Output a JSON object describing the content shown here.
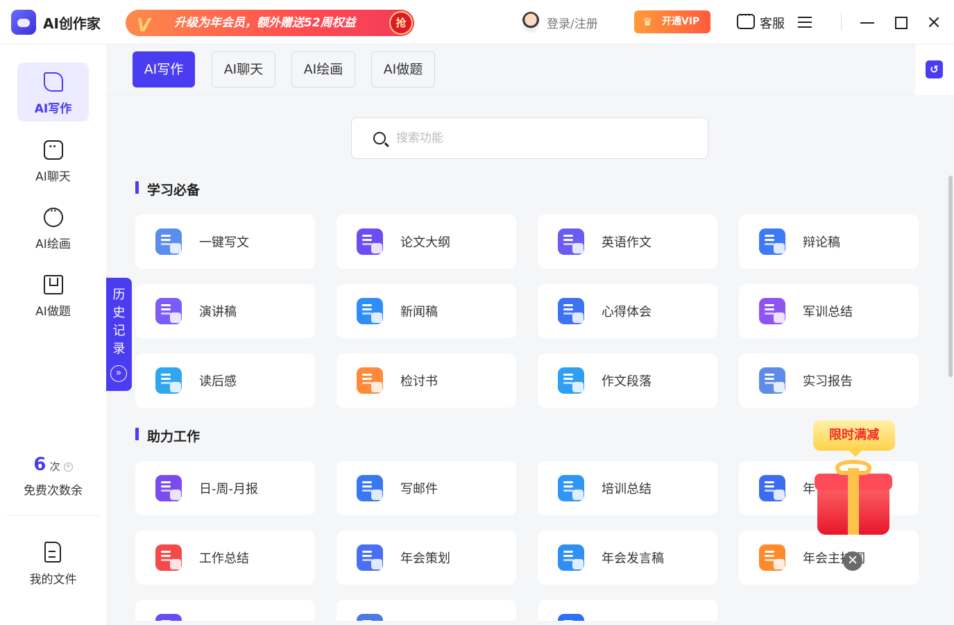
{
  "app": {
    "title": "AI创作家"
  },
  "titlebar": {
    "banner_text": "升级为年会员，额外赠送52周权益",
    "banner_grab": "抢",
    "login": "登录/注册",
    "vip": "开通VIP",
    "service": "客服"
  },
  "sidebar": {
    "items": [
      {
        "label": "AI写作",
        "icon": "pen-icon",
        "active": true
      },
      {
        "label": "AI聊天",
        "icon": "chat-icon",
        "active": false
      },
      {
        "label": "AI绘画",
        "icon": "palette-icon",
        "active": false
      },
      {
        "label": "AI做题",
        "icon": "bookmark-icon",
        "active": false
      }
    ],
    "free_count": "6",
    "free_unit": "次",
    "free_label": "免费次数余",
    "my_files": "我的文件"
  },
  "history": {
    "label": "历史记录",
    "arrow": "»"
  },
  "tabs": [
    {
      "label": "AI写作",
      "active": true
    },
    {
      "label": "AI聊天",
      "active": false
    },
    {
      "label": "AI绘画",
      "active": false
    },
    {
      "label": "AI做题",
      "active": false
    }
  ],
  "search": {
    "placeholder": "搜索功能",
    "value": ""
  },
  "sections": [
    {
      "title": "学习必备",
      "items": [
        {
          "label": "一键写文",
          "color": "#5b8def"
        },
        {
          "label": "论文大纲",
          "color": "#6c4cf5"
        },
        {
          "label": "英语作文",
          "color": "#6a5cf0"
        },
        {
          "label": "辩论稿",
          "color": "#3d7af7"
        },
        {
          "label": "演讲稿",
          "color": "#7b5cf6"
        },
        {
          "label": "新闻稿",
          "color": "#2f8ef5"
        },
        {
          "label": "心得体会",
          "color": "#3f72f0"
        },
        {
          "label": "军训总结",
          "color": "#8e54f2"
        },
        {
          "label": "读后感",
          "color": "#2fa6f0"
        },
        {
          "label": "检讨书",
          "color": "#ff8a3a"
        },
        {
          "label": "作文段落",
          "color": "#2f9ff2"
        },
        {
          "label": "实习报告",
          "color": "#5c8ce8"
        }
      ]
    },
    {
      "title": "助力工作",
      "items": [
        {
          "label": "日-周-月报",
          "color": "#7a4cf0"
        },
        {
          "label": "写邮件",
          "color": "#3a78f2"
        },
        {
          "label": "培训总结",
          "color": "#2f96f5"
        },
        {
          "label": "年",
          "color": "#3c6cf0"
        },
        {
          "label": "工作总结",
          "color": "#f54a4a"
        },
        {
          "label": "年会策划",
          "color": "#4a6ff2"
        },
        {
          "label": "年会发言稿",
          "color": "#2f90f2"
        },
        {
          "label": "年会主持词",
          "color": "#ff8a2c"
        },
        {
          "label": "",
          "color": "#6a4cf0"
        },
        {
          "label": "",
          "color": "#4c78e8"
        },
        {
          "label": "",
          "color": "#2f70f0"
        }
      ]
    }
  ],
  "promo": {
    "badge": "限时满减",
    "close": "✕"
  }
}
